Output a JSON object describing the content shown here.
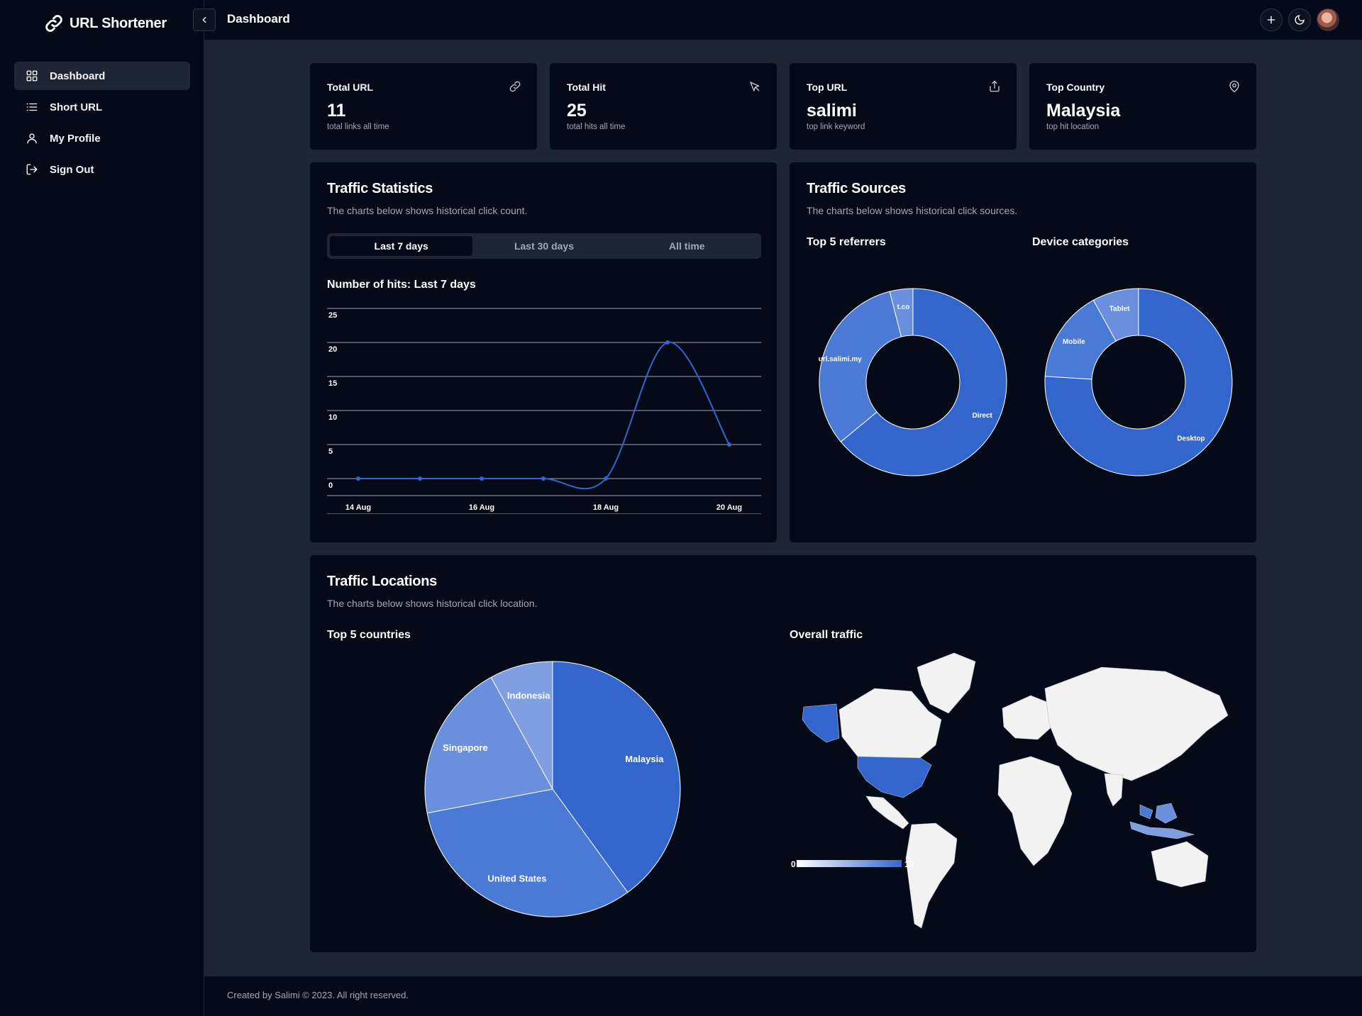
{
  "app": {
    "title": "URL Shortener"
  },
  "sidebar": {
    "items": [
      {
        "label": "Dashboard",
        "icon": "dashboard-icon",
        "active": true
      },
      {
        "label": "Short URL",
        "icon": "list-icon",
        "active": false
      },
      {
        "label": "My Profile",
        "icon": "user-icon",
        "active": false
      },
      {
        "label": "Sign Out",
        "icon": "sign-out-icon",
        "active": false
      }
    ]
  },
  "header": {
    "title": "Dashboard"
  },
  "stats": [
    {
      "label": "Total URL",
      "value": "11",
      "sub": "total links all time",
      "icon": "link-icon"
    },
    {
      "label": "Total Hit",
      "value": "25",
      "sub": "total hits all time",
      "icon": "pointer-icon"
    },
    {
      "label": "Top URL",
      "value": "salimi",
      "sub": "top link keyword",
      "icon": "share-icon"
    },
    {
      "label": "Top Country",
      "value": "Malaysia",
      "sub": "top hit location",
      "icon": "location-pin-icon"
    }
  ],
  "traffic_statistics": {
    "title": "Traffic Statistics",
    "subtitle": "The charts below shows historical click count.",
    "tabs": [
      "Last 7 days",
      "Last 30 days",
      "All time"
    ],
    "active_tab": "Last 7 days",
    "chart_title": "Number of hits: Last 7 days"
  },
  "traffic_sources": {
    "title": "Traffic Sources",
    "subtitle": "The charts below shows historical click sources.",
    "referrers_title": "Top 5 referrers",
    "devices_title": "Device categories"
  },
  "traffic_locations": {
    "title": "Traffic Locations",
    "subtitle": "The charts below shows historical click location.",
    "countries_title": "Top 5 countries",
    "map_title": "Overall traffic"
  },
  "colors": {
    "accent": "#3366cc",
    "page_bg": "#1e2636",
    "card_bg": "#040a18",
    "muted_text": "#a0a7b6"
  },
  "chart_data": [
    {
      "type": "line",
      "x": [
        "14 Aug",
        "15 Aug",
        "16 Aug",
        "17 Aug",
        "18 Aug",
        "19 Aug",
        "20 Aug"
      ],
      "x_tick_labels": [
        "14 Aug",
        "16 Aug",
        "18 Aug",
        "20 Aug"
      ],
      "series": [
        {
          "values": [
            0,
            0,
            0,
            0,
            0,
            20,
            5
          ]
        }
      ],
      "y_ticks": [
        "0",
        "5",
        "10",
        "15",
        "20",
        "25"
      ],
      "ylim": [
        0,
        25
      ],
      "grid": true
    },
    {
      "type": "pie",
      "donut": true,
      "labels": [
        "Direct",
        "url.salimi.my",
        "t.co"
      ],
      "values": [
        16,
        8,
        1
      ]
    },
    {
      "type": "pie",
      "donut": true,
      "labels": [
        "Desktop",
        "Mobile",
        "Tablet"
      ],
      "values": [
        19,
        4,
        2
      ]
    },
    {
      "type": "pie",
      "labels": [
        "Malaysia",
        "United States",
        "Singapore",
        "Indonesia"
      ],
      "values": [
        10,
        8,
        5,
        2
      ]
    },
    {
      "type": "heatmap",
      "kind": "world-map",
      "highlighted": [
        "United States",
        "Malaysia",
        "Singapore",
        "Indonesia"
      ],
      "scale_min": "0",
      "scale_max": "10"
    }
  ],
  "footer": {
    "text": "Created by Salimi © 2023. All right reserved."
  }
}
